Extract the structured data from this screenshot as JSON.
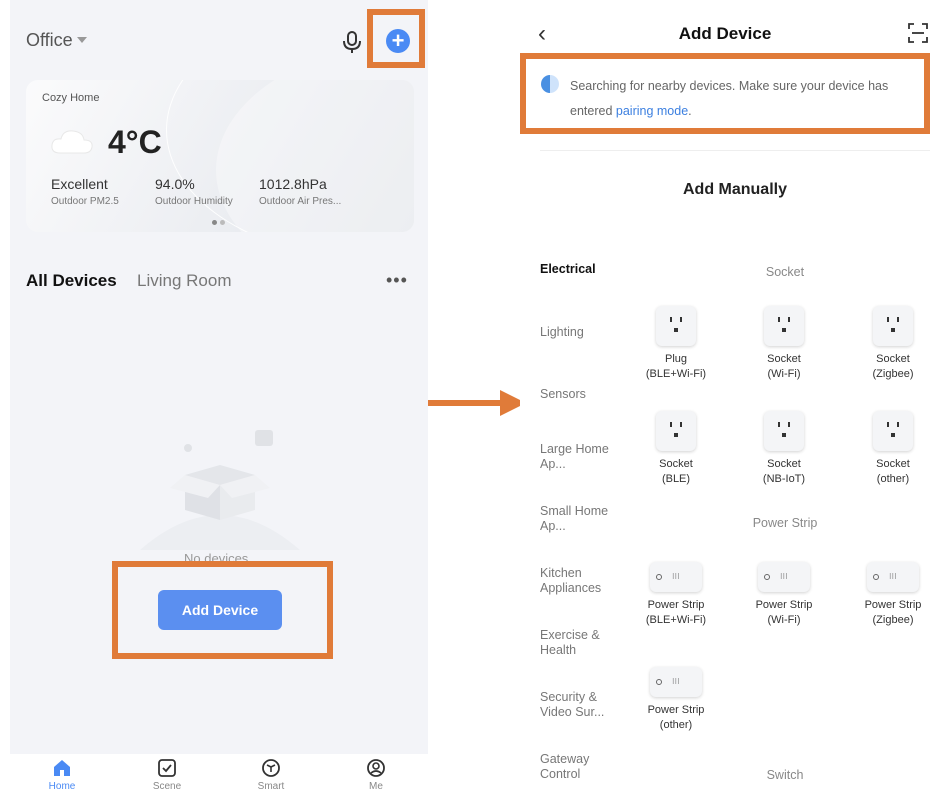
{
  "left": {
    "location": "Office",
    "weather": {
      "home_name": "Cozy Home",
      "temperature": "4°C",
      "stats": [
        {
          "value": "Excellent",
          "label": "Outdoor PM2.5"
        },
        {
          "value": "94.0%",
          "label": "Outdoor Humidity"
        },
        {
          "value": "1012.8hPa",
          "label": "Outdoor Air Pres..."
        }
      ]
    },
    "tabs": {
      "all": "All Devices",
      "room": "Living Room"
    },
    "empty_text": "No devices",
    "add_device_button": "Add Device",
    "tabbar": [
      {
        "label": "Home",
        "icon": "home-icon"
      },
      {
        "label": "Scene",
        "icon": "scene-icon"
      },
      {
        "label": "Smart",
        "icon": "smart-icon"
      },
      {
        "label": "Me",
        "icon": "me-icon"
      }
    ]
  },
  "right": {
    "title": "Add Device",
    "search_text": "Searching for nearby devices. Make sure your device has entered",
    "search_link": "pairing mode",
    "search_end": ".",
    "add_manually": "Add Manually",
    "categories": [
      {
        "label": "Electrical",
        "selected": true
      },
      {
        "label": "Lighting"
      },
      {
        "label": "Sensors"
      },
      {
        "label": "Large Home Ap..."
      },
      {
        "label": "Small Home Ap..."
      },
      {
        "label": "Kitchen Appliances"
      },
      {
        "label": "Exercise & Health"
      },
      {
        "label": "Security & Video Sur..."
      },
      {
        "label": "Gateway Control"
      }
    ],
    "sections": {
      "socket": "Socket",
      "power_strip": "Power Strip",
      "switch": "Switch"
    },
    "socket_items": [
      {
        "line1": "Plug",
        "line2": "(BLE+Wi-Fi)"
      },
      {
        "line1": "Socket",
        "line2": "(Wi-Fi)"
      },
      {
        "line1": "Socket",
        "line2": "(Zigbee)"
      },
      {
        "line1": "Socket",
        "line2": "(BLE)"
      },
      {
        "line1": "Socket",
        "line2": "(NB-IoT)"
      },
      {
        "line1": "Socket",
        "line2": "(other)"
      }
    ],
    "strip_items": [
      {
        "line1": "Power Strip",
        "line2": "(BLE+Wi-Fi)"
      },
      {
        "line1": "Power Strip",
        "line2": "(Wi-Fi)"
      },
      {
        "line1": "Power Strip",
        "line2": "(Zigbee)"
      },
      {
        "line1": "Power Strip",
        "line2": "(other)"
      }
    ]
  },
  "colors": {
    "accent": "#4a8af4",
    "highlight": "#e07b39",
    "button": "#5b8ff0"
  }
}
